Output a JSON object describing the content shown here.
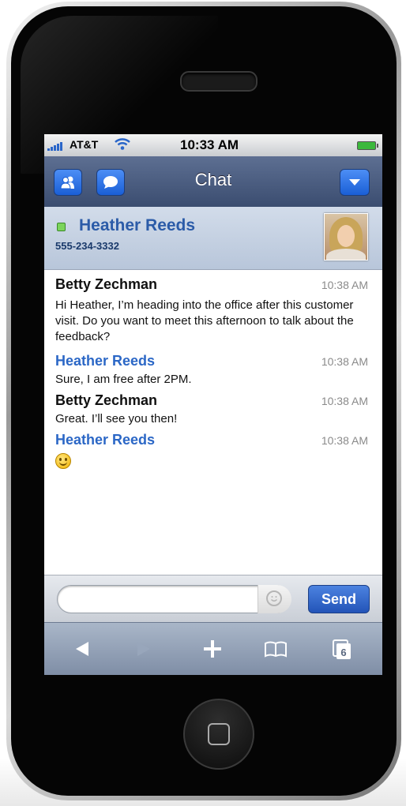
{
  "status": {
    "carrier": "AT&T",
    "time": "10:33 AM"
  },
  "nav": {
    "title": "Chat"
  },
  "contact": {
    "name": "Heather Reeds",
    "phone": "555-234-3332"
  },
  "messages": [
    {
      "sender": "Betty Zechman",
      "time": "10:38 AM",
      "text": "Hi Heather, I’m heading into the office after this customer visit. Do you want to meet this afternoon to talk about the feedback?",
      "self": false
    },
    {
      "sender": "Heather Reeds",
      "time": "10:38 AM",
      "text": "Sure, I am free after 2PM.",
      "self": true
    },
    {
      "sender": "Betty Zechman",
      "time": "10:38 AM",
      "text": "Great. I’ll see you then!",
      "self": false
    },
    {
      "sender": "Heather Reeds",
      "time": "10:38 AM",
      "text": "",
      "self": true,
      "emoji": "smiley-icon"
    }
  ],
  "composer": {
    "placeholder": "",
    "send_label": "Send"
  },
  "toolbar": {
    "tabs_count": "6"
  },
  "colors": {
    "accent": "#2b67c6",
    "navbar": "#4a5c80",
    "presence": "#7bd45b"
  }
}
